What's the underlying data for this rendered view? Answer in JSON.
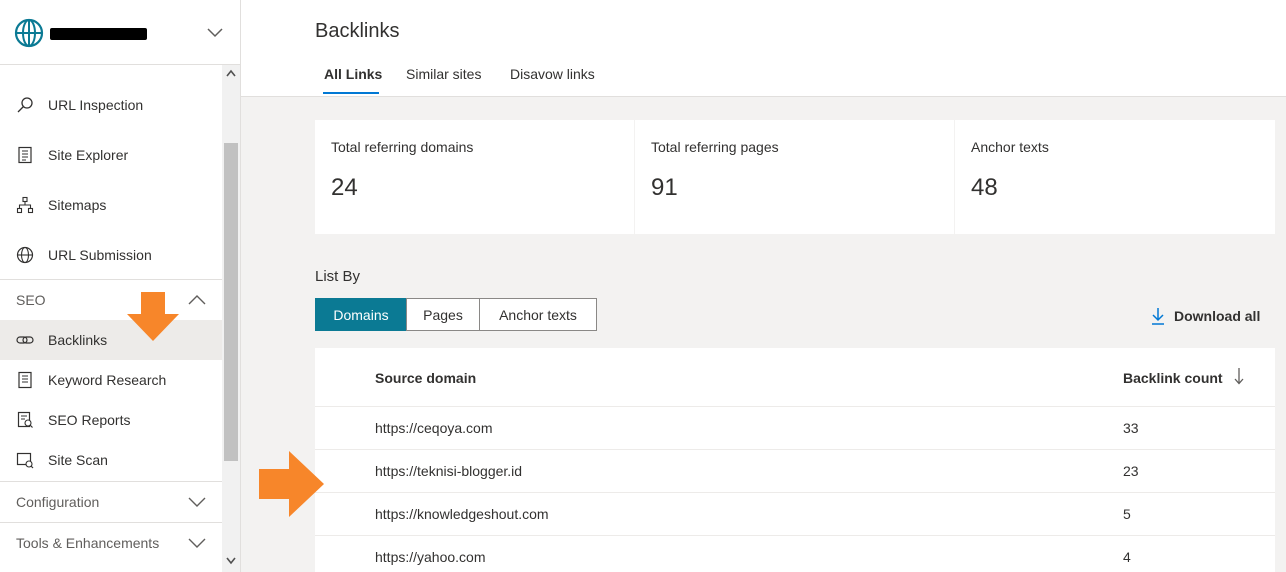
{
  "sidebar": {
    "site_chevron_icon": "chevron-down-icon",
    "items": [
      {
        "label": "URL Inspection",
        "icon": "search-icon"
      },
      {
        "label": "Site Explorer",
        "icon": "document-list-icon"
      },
      {
        "label": "Sitemaps",
        "icon": "sitemap-icon"
      },
      {
        "label": "URL Submission",
        "icon": "globe-icon"
      }
    ],
    "sections": {
      "seo": {
        "label": "SEO",
        "expanded": true
      },
      "configuration": {
        "label": "Configuration",
        "expanded": false
      },
      "tools": {
        "label": "Tools & Enhancements",
        "expanded": false
      }
    },
    "seo_items": [
      {
        "label": "Backlinks",
        "icon": "link-icon",
        "active": true
      },
      {
        "label": "Keyword Research",
        "icon": "document-icon"
      },
      {
        "label": "SEO Reports",
        "icon": "report-icon"
      },
      {
        "label": "Site Scan",
        "icon": "scan-icon"
      }
    ]
  },
  "header": {
    "title": "Backlinks",
    "tabs": [
      {
        "label": "All Links",
        "active": true
      },
      {
        "label": "Similar sites",
        "active": false
      },
      {
        "label": "Disavow links",
        "active": false
      }
    ]
  },
  "stats": [
    {
      "label": "Total referring domains",
      "value": "24"
    },
    {
      "label": "Total referring pages",
      "value": "91"
    },
    {
      "label": "Anchor texts",
      "value": "48"
    }
  ],
  "list_by": {
    "label": "List By",
    "options": [
      "Domains",
      "Pages",
      "Anchor texts"
    ],
    "selected": "Domains"
  },
  "download_all": "Download all",
  "table": {
    "columns": [
      "Source domain",
      "Backlink count"
    ],
    "sort_column": "Backlink count",
    "sort_direction": "descending",
    "rows": [
      {
        "domain": "https://ceqoya.com",
        "count": "33"
      },
      {
        "domain": "https://teknisi-blogger.id",
        "count": "23"
      },
      {
        "domain": "https://knowledgeshout.com",
        "count": "5"
      },
      {
        "domain": "https://yahoo.com",
        "count": "4"
      }
    ]
  },
  "colors": {
    "accent": "#0078d4",
    "selected_segment": "#0b7a94",
    "annotation_arrow": "#f7862a",
    "active_nav_bg": "#edebe9"
  }
}
